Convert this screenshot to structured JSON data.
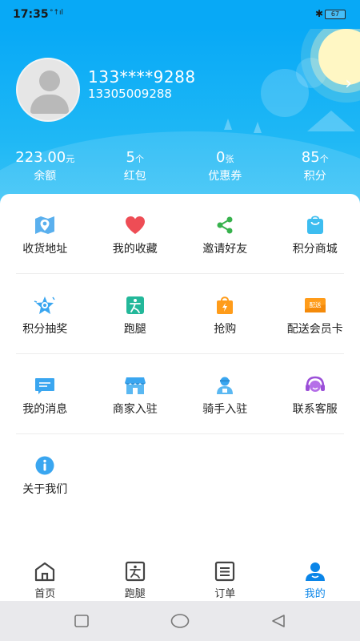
{
  "status_bar": {
    "time": "17:35",
    "signal": "°↑ıl",
    "bluetooth": "✱",
    "battery": "67"
  },
  "profile": {
    "name": "133****9288",
    "phone": "13305009288"
  },
  "stats": [
    {
      "value": "223.00",
      "unit": "元",
      "label": "余额"
    },
    {
      "value": "5",
      "unit": "个",
      "label": "红包"
    },
    {
      "value": "0",
      "unit": "张",
      "label": "优惠券"
    },
    {
      "value": "85",
      "unit": "个",
      "label": "积分"
    }
  ],
  "menu": [
    {
      "label": "收货地址",
      "icon": "map-location-icon"
    },
    {
      "label": "我的收藏",
      "icon": "heart-icon"
    },
    {
      "label": "邀请好友",
      "icon": "share-icon"
    },
    {
      "label": "积分商城",
      "icon": "shopping-bag-icon"
    },
    {
      "label": "积分抽奖",
      "icon": "star-lottery-icon"
    },
    {
      "label": "跑腿",
      "icon": "runner-icon"
    },
    {
      "label": "抢购",
      "icon": "flash-sale-bag-icon"
    },
    {
      "label": "配送会员卡",
      "icon": "delivery-card-icon"
    },
    {
      "label": "我的消息",
      "icon": "message-icon"
    },
    {
      "label": "商家入驻",
      "icon": "store-icon"
    },
    {
      "label": "骑手入驻",
      "icon": "rider-icon"
    },
    {
      "label": "联系客服",
      "icon": "headset-icon"
    },
    {
      "label": "关于我们",
      "icon": "info-icon"
    }
  ],
  "card_badge": "配送",
  "tabs": [
    {
      "label": "首页",
      "icon": "home-icon"
    },
    {
      "label": "跑腿",
      "icon": "runner-icon"
    },
    {
      "label": "订单",
      "icon": "order-list-icon"
    },
    {
      "label": "我的",
      "icon": "user-icon",
      "active": true
    }
  ],
  "colors": {
    "primary": "#08a9f6",
    "tab_active": "#0a85e8"
  }
}
